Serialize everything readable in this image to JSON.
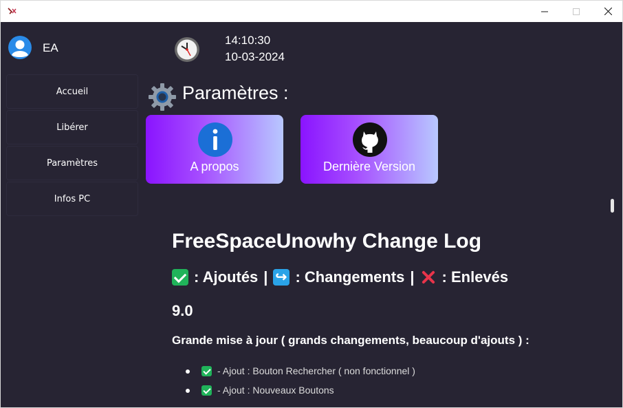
{
  "window": {
    "icon": "app-logo-icon",
    "controls": [
      "minimize-icon",
      "maximize-icon",
      "close-icon"
    ]
  },
  "user": {
    "name": "EA",
    "avatar_icon": "user-avatar-icon"
  },
  "clock": {
    "time": "14:10:30",
    "date": "10-03-2024",
    "icon": "clock-icon"
  },
  "sidebar": {
    "items": [
      {
        "label": "Accueil"
      },
      {
        "label": "Libérer"
      },
      {
        "label": "Paramètres"
      },
      {
        "label": "Infos PC"
      }
    ]
  },
  "settings": {
    "title": "Paramètres :",
    "icon": "gear-icon",
    "cards": [
      {
        "label": "A propos",
        "icon": "info-icon"
      },
      {
        "label": "Dernière Version",
        "icon": "github-icon"
      }
    ]
  },
  "changelog": {
    "title": "FreeSpaceUnowhy Change Log",
    "legend": {
      "added": ": Ajoutés",
      "changed": ": Changements",
      "removed": ": Enlevés",
      "sep": "|"
    },
    "version": "9.0",
    "subtitle": "Grande mise à jour ( grands changements, beaucoup d'ajouts ) :",
    "items": [
      {
        "text": "- Ajout : Bouton Rechercher ( non fonctionnel )"
      },
      {
        "text": "- Ajout : Nouveaux Boutons"
      }
    ]
  },
  "colors": {
    "background": "#272433",
    "card_gradient_start": "#8a14ff",
    "card_gradient_end": "#b8c8ff",
    "check_green": "#20b35a",
    "change_blue": "#2aa3e8",
    "cross_red": "#e8344a"
  }
}
